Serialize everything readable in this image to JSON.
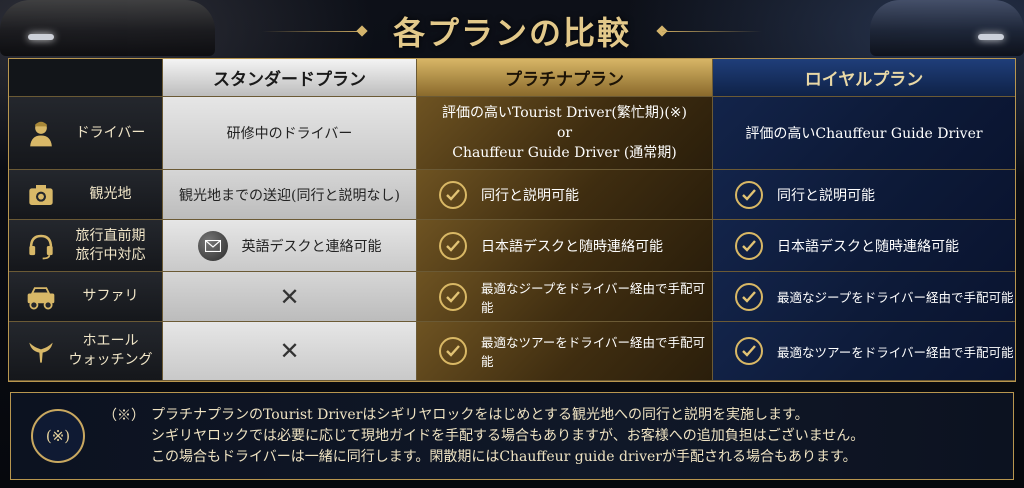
{
  "header": {
    "title": "各プランの比較"
  },
  "plans": [
    {
      "name": "スタンダードプラン",
      "color": "#d9d9d9"
    },
    {
      "name": "プラチナプラン",
      "color": "#c9a04e"
    },
    {
      "name": "ロイヤルプラン",
      "color": "#1a3468"
    }
  ],
  "rows": [
    {
      "label": "ドライバー",
      "icon": "driver-icon",
      "standard": "研修中のドライバー",
      "platinum": [
        "評価の高いTourist Driver(繁忙期)(※)",
        "or",
        "Chauffeur Guide Driver (通常期)"
      ],
      "royal": "評価の高いChauffeur Guide Driver"
    },
    {
      "label": "観光地",
      "icon": "camera-icon",
      "standard": "観光地までの送迎(同行と説明なし)",
      "platinum": "同行と説明可能",
      "royal": "同行と説明可能"
    },
    {
      "label_lines": [
        "旅行直前期",
        "旅行中対応"
      ],
      "icon": "headset-icon",
      "standard": "英語デスクと連絡可能",
      "platinum": "日本語デスクと随時連絡可能",
      "royal": "日本語デスクと随時連絡可能"
    },
    {
      "label": "サファリ",
      "icon": "jeep-icon",
      "standard": "✕",
      "platinum": "最適なジープをドライバー経由で手配可能",
      "royal": "最適なジープをドライバー経由で手配可能"
    },
    {
      "label_lines": [
        "ホエール",
        "ウォッチング"
      ],
      "icon": "whale-tail-icon",
      "standard": "✕",
      "platinum": "最適なツアーをドライバー経由で手配可能",
      "royal": "最適なツアーをドライバー経由で手配可能"
    }
  ],
  "note": {
    "badge": "(※)",
    "mark": "（※）",
    "lines": [
      "プラチナプランのTourist Driverはシギリヤロックをはじめとする観光地への同行と説明を実施します。",
      "シギリヤロックでは必要に応じて現地ガイドを手配する場合もありますが、お客様への追加負担はございません。",
      "この場合もドライバーは一緒に同行します。閑散期にはChauffeur guide driverが手配される場合もあります。"
    ]
  },
  "colors": {
    "gold": "#c9a860",
    "navy": "#0f2247"
  }
}
